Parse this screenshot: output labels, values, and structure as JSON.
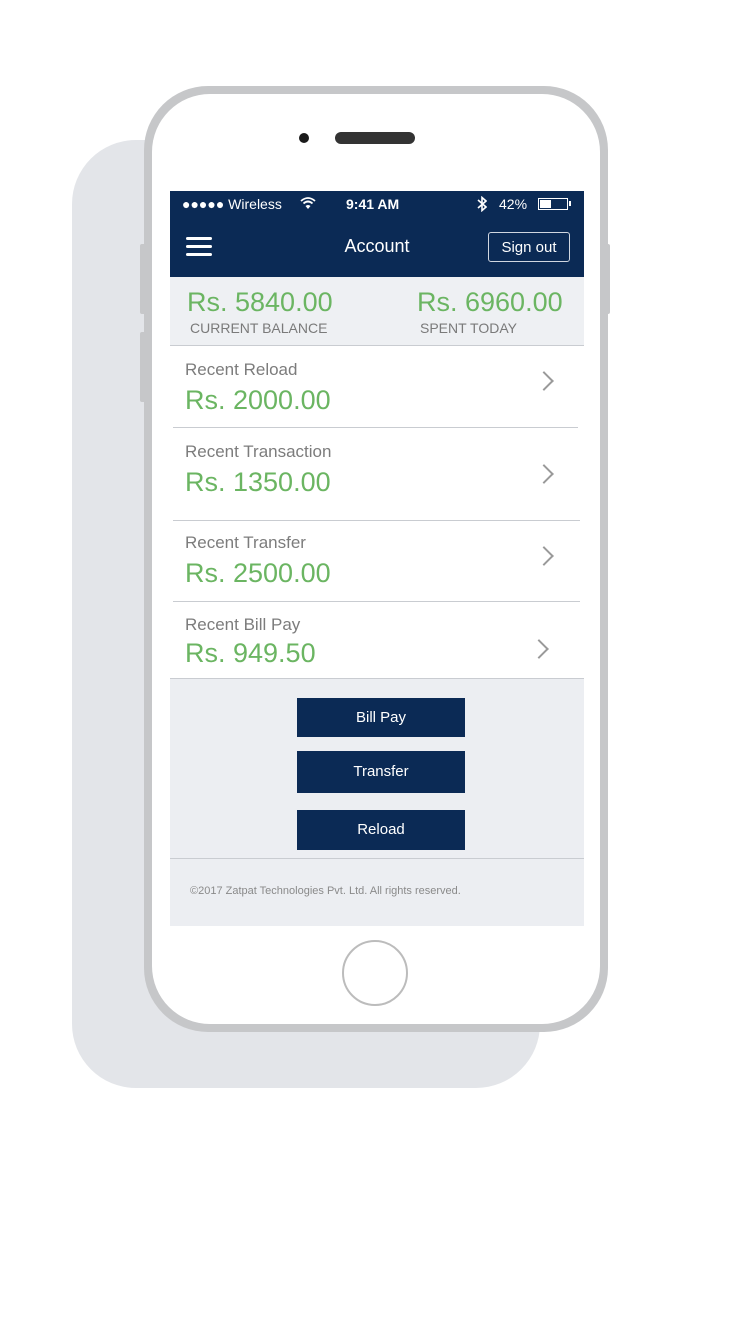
{
  "status_bar": {
    "carrier": "●●●●● Wireless",
    "wifi_icon": "wifi-icon",
    "time": "9:41 AM",
    "bluetooth_icon": "bluetooth-icon",
    "battery": "42%",
    "battery_level": 0.42
  },
  "header": {
    "title": "Account",
    "sign_out_label": "Sign out"
  },
  "summary": {
    "current_balance": "Rs. 5840.00",
    "current_balance_label": "CURRENT BALANCE",
    "spent_today": "Rs. 6960.00",
    "spent_today_label": "SPENT TODAY"
  },
  "items": [
    {
      "label": "Recent Reload",
      "value": "Rs. 2000.00"
    },
    {
      "label": "Recent Transaction",
      "value": "Rs. 1350.00"
    },
    {
      "label": "Recent Transfer",
      "value": "Rs. 2500.00"
    },
    {
      "label": "Recent Bill Pay",
      "value": "Rs. 949.50"
    }
  ],
  "actions": {
    "bill_pay": "Bill Pay",
    "transfer": "Transfer",
    "reload": "Reload"
  },
  "footer": {
    "copyright": "©2017 Zatpat Technologies Pvt. Ltd. All rights reserved."
  },
  "colors": {
    "primary": "#0b2a55",
    "accent_green": "#6bb562",
    "muted_text": "#7c7c7c"
  }
}
